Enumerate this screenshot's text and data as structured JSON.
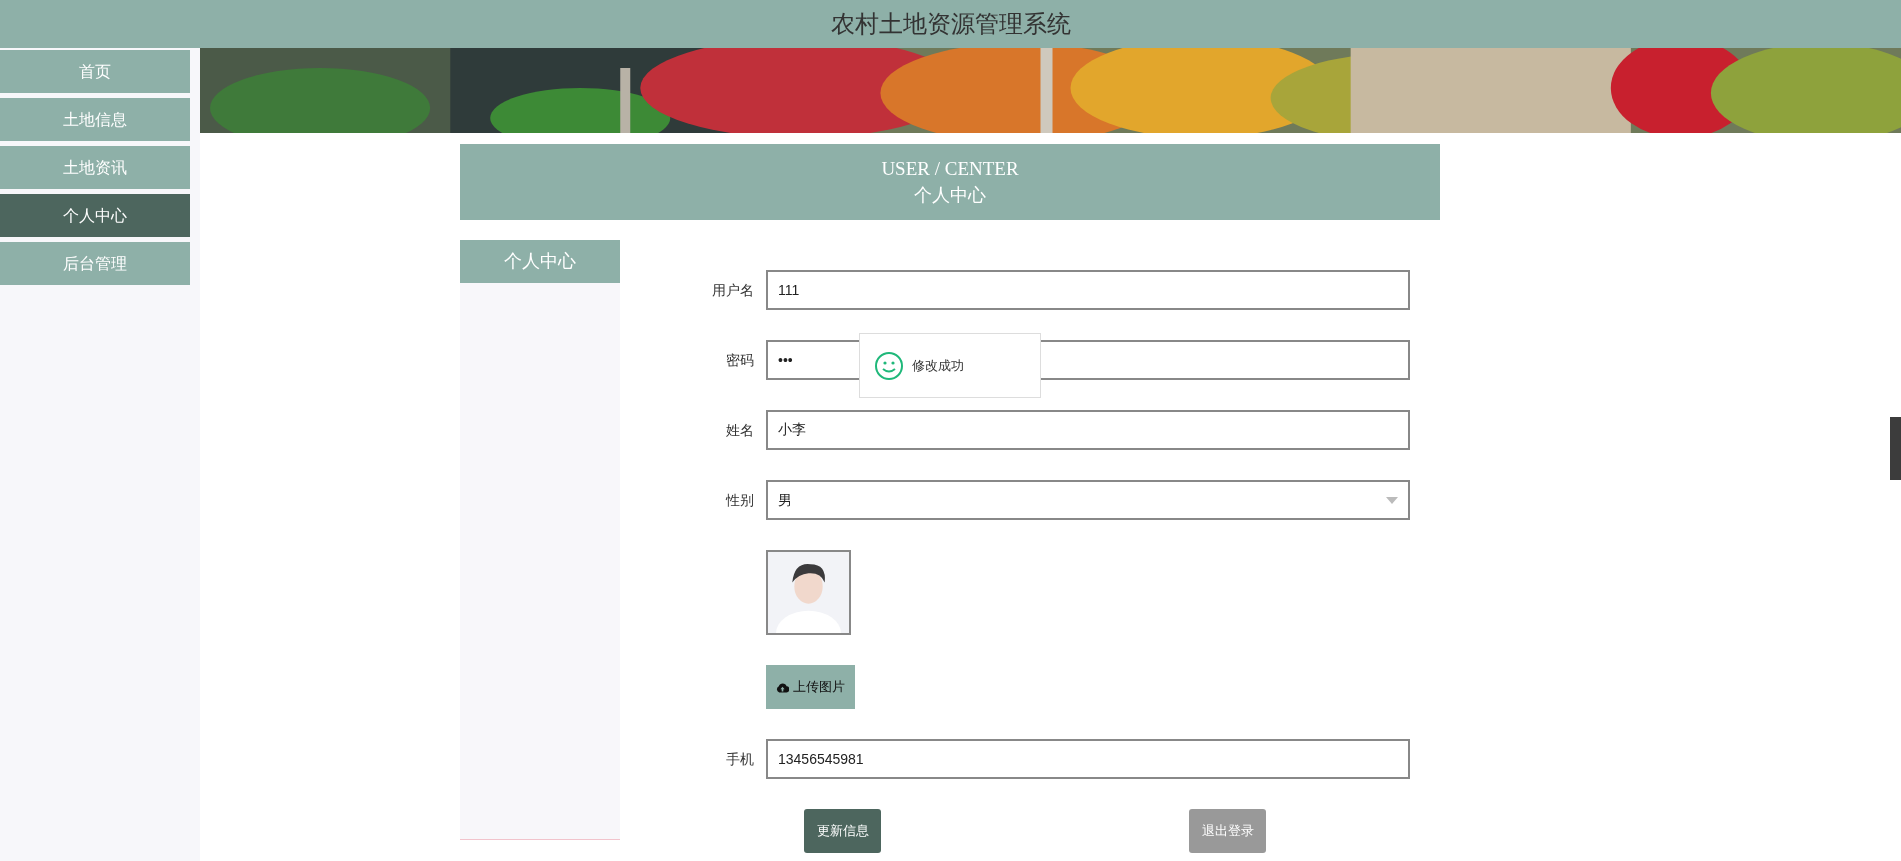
{
  "header": {
    "title": "农村土地资源管理系统"
  },
  "nav": [
    {
      "label": "首页",
      "selected": false
    },
    {
      "label": "土地信息",
      "selected": false
    },
    {
      "label": "土地资讯",
      "selected": false
    },
    {
      "label": "个人中心",
      "selected": true
    },
    {
      "label": "后台管理",
      "selected": false
    }
  ],
  "page_heading": {
    "title": "USER / CENTER",
    "subtitle": "个人中心"
  },
  "side_menu": {
    "title": "个人中心"
  },
  "form": {
    "fields": [
      {
        "kind": "text",
        "label": "用户名",
        "value": "111"
      },
      {
        "kind": "text",
        "label": "密码",
        "value": "•••"
      },
      {
        "kind": "text",
        "label": "姓名",
        "value": "小李"
      },
      {
        "kind": "select",
        "label": "性别",
        "value": "男"
      },
      {
        "kind": "avatar"
      },
      {
        "kind": "upload",
        "button": "上传图片"
      },
      {
        "kind": "text",
        "label": "手机",
        "value": "13456545981"
      }
    ],
    "buttons": [
      {
        "label": "更新信息",
        "kind": "primary"
      },
      {
        "label": "退出登录",
        "kind": "secondary"
      }
    ]
  },
  "toast": {
    "message": "修改成功"
  }
}
